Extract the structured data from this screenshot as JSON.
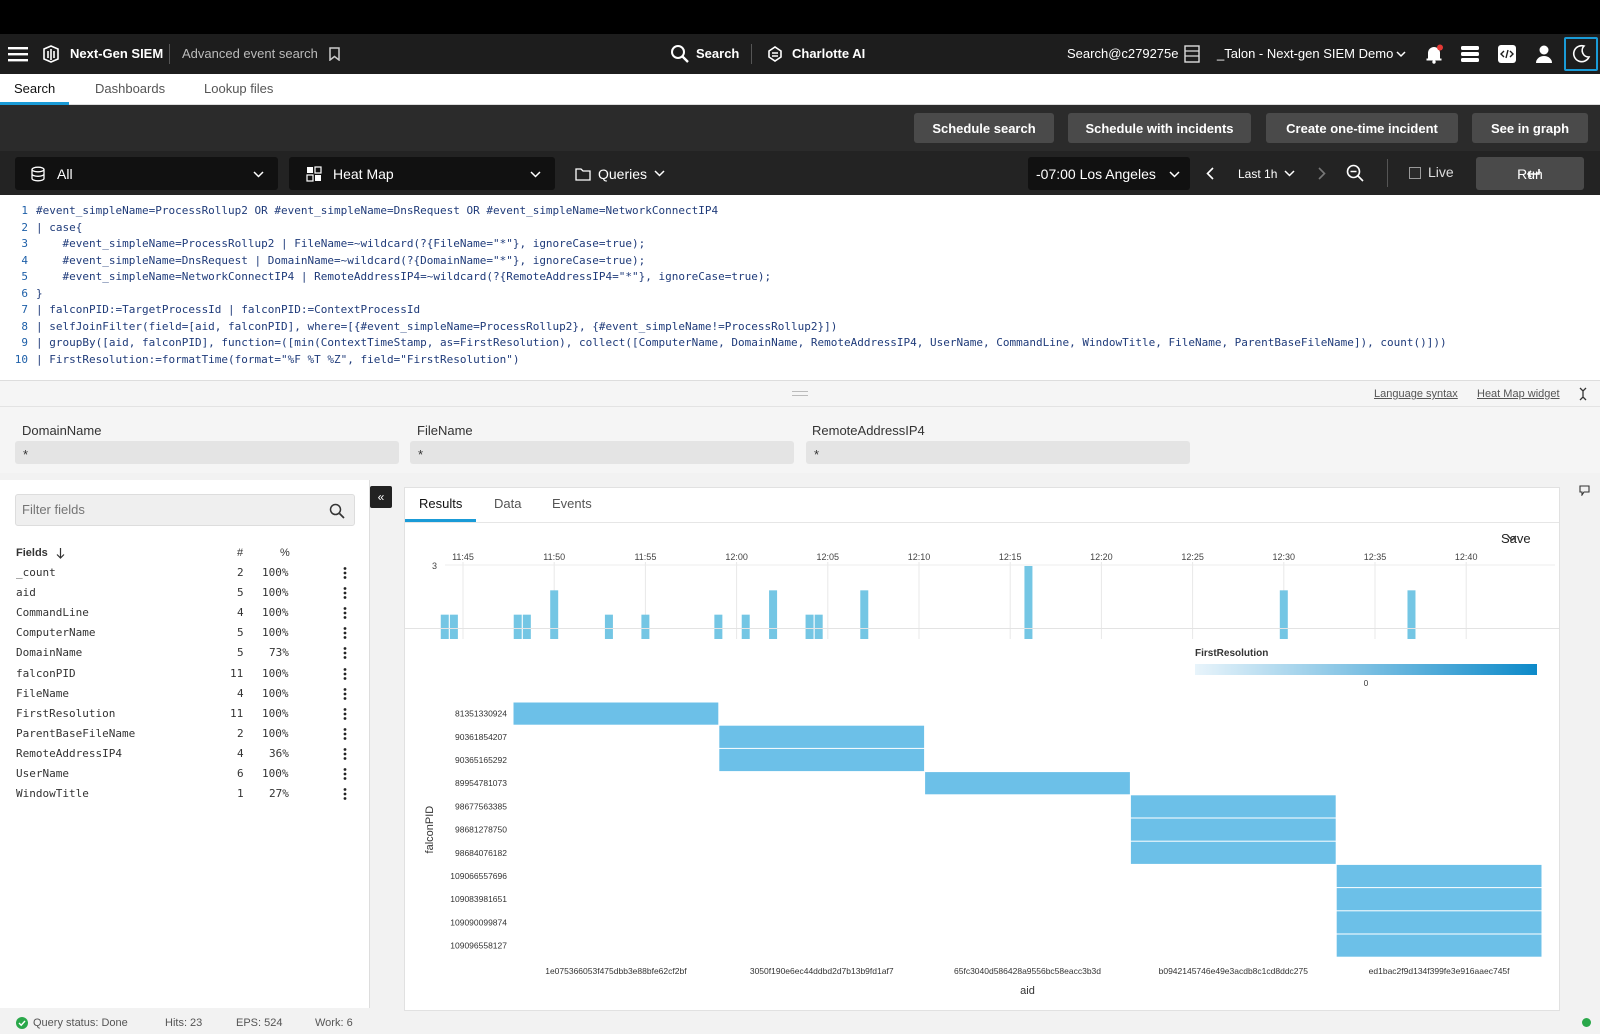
{
  "navbar": {
    "app_name": "Next-Gen SIEM",
    "page_title": "Advanced event search",
    "search_label": "Search",
    "charlotte_label": "Charlotte AI",
    "repo": "Search@c279275e",
    "tenant": "_Talon - Next-gen SIEM Demo"
  },
  "subtabs": [
    "Search",
    "Dashboards",
    "Lookup files"
  ],
  "actions": {
    "schedule_search": "Schedule search",
    "schedule_incidents": "Schedule with incidents",
    "create_incident": "Create one-time incident",
    "see_graph": "See in graph"
  },
  "querybar": {
    "repo_filter": "All",
    "widget": "Heat Map",
    "queries": "Queries",
    "timezone": "-07:00 Los Angeles",
    "timerange": "Last 1h",
    "live": "Live",
    "run": "Run"
  },
  "editor": {
    "lines": [
      {
        "n": "1",
        "code": "#event_simpleName=ProcessRollup2 OR #event_simpleName=DnsRequest OR #event_simpleName=NetworkConnectIP4"
      },
      {
        "n": "2",
        "code": "| case{"
      },
      {
        "n": "3",
        "code": "    #event_simpleName=ProcessRollup2 | FileName=~wildcard(?{FileName=\"*\"}, ignoreCase=true);"
      },
      {
        "n": "4",
        "code": "    #event_simpleName=DnsRequest | DomainName=~wildcard(?{DomainName=\"*\"}, ignoreCase=true);"
      },
      {
        "n": "5",
        "code": "    #event_simpleName=NetworkConnectIP4 | RemoteAddressIP4=~wildcard(?{RemoteAddressIP4=\"*\"}, ignoreCase=true);"
      },
      {
        "n": "6",
        "code": "}"
      },
      {
        "n": "7",
        "code": "| falconPID:=TargetProcessId | falconPID:=ContextProcessId"
      },
      {
        "n": "8",
        "code": "| selfJoinFilter(field=[aid, falconPID], where=[{#event_simpleName=ProcessRollup2}, {#event_simpleName!=ProcessRollup2}])"
      },
      {
        "n": "9",
        "code": "| groupBy([aid, falconPID], function=([min(ContextTimeStamp, as=FirstResolution), collect([ComputerName, DomainName, RemoteAddressIP4, UserName, CommandLine, WindowTitle, FileName, ParentBaseFileName]), count()]))"
      },
      {
        "n": "10",
        "code": "| FirstResolution:=formatTime(format=\"%F %T %Z\", field=\"FirstResolution\")"
      }
    ],
    "language_syntax": "Language syntax",
    "widget_link": "Heat Map widget"
  },
  "params": [
    {
      "label": "DomainName",
      "value": "*"
    },
    {
      "label": "FileName",
      "value": "*"
    },
    {
      "label": "RemoteAddressIP4",
      "value": "*"
    }
  ],
  "fields": {
    "filter_placeholder": "Filter fields",
    "header": {
      "name": "Fields",
      "count": "#",
      "pct": "%"
    },
    "rows": [
      {
        "name": "_count",
        "count": "2",
        "pct": "100%"
      },
      {
        "name": "aid",
        "count": "5",
        "pct": "100%"
      },
      {
        "name": "CommandLine",
        "count": "4",
        "pct": "100%"
      },
      {
        "name": "ComputerName",
        "count": "5",
        "pct": "100%"
      },
      {
        "name": "DomainName",
        "count": "5",
        "pct": "73%"
      },
      {
        "name": "falconPID",
        "count": "11",
        "pct": "100%"
      },
      {
        "name": "FileName",
        "count": "4",
        "pct": "100%"
      },
      {
        "name": "FirstResolution",
        "count": "11",
        "pct": "100%"
      },
      {
        "name": "ParentBaseFileName",
        "count": "2",
        "pct": "100%"
      },
      {
        "name": "RemoteAddressIP4",
        "count": "4",
        "pct": "36%"
      },
      {
        "name": "UserName",
        "count": "6",
        "pct": "100%"
      },
      {
        "name": "WindowTitle",
        "count": "1",
        "pct": "27%"
      }
    ]
  },
  "results": {
    "tabs": [
      "Results",
      "Data",
      "Events"
    ],
    "save": "Save"
  },
  "status": {
    "query_status": "Query status: Done",
    "hits": "Hits: 23",
    "eps": "EPS: 524",
    "work": "Work: 6"
  },
  "colors": {
    "accent": "#1a9bd7",
    "cell": "#6cc0e8",
    "hist_bar": "#74c6e4"
  },
  "chart_data": [
    {
      "type": "bar",
      "title": "",
      "x_ticks": [
        "11:45",
        "11:50",
        "11:55",
        "12:00",
        "12:05",
        "12:10",
        "12:15",
        "12:20",
        "12:25",
        "12:30",
        "12:35",
        "12:40"
      ],
      "ymax_label": "3",
      "ylim": [
        0,
        3
      ],
      "bars": [
        {
          "t": "11:44",
          "v": 1
        },
        {
          "t": "11:44.5",
          "v": 1
        },
        {
          "t": "11:48",
          "v": 1
        },
        {
          "t": "11:48.5",
          "v": 1
        },
        {
          "t": "11:50",
          "v": 2
        },
        {
          "t": "11:53",
          "v": 1
        },
        {
          "t": "11:55",
          "v": 1
        },
        {
          "t": "11:59",
          "v": 1
        },
        {
          "t": "12:00.5",
          "v": 1
        },
        {
          "t": "12:02",
          "v": 2
        },
        {
          "t": "12:04",
          "v": 1
        },
        {
          "t": "12:04.5",
          "v": 1
        },
        {
          "t": "12:07",
          "v": 2
        },
        {
          "t": "12:16",
          "v": 3
        },
        {
          "t": "12:30",
          "v": 2
        },
        {
          "t": "12:37",
          "v": 2
        }
      ]
    },
    {
      "type": "heatmap",
      "xlabel": "aid",
      "ylabel": "falconPID",
      "legend_title": "FirstResolution",
      "legend_tick": "0",
      "x": [
        "1e075366053f475dbb3e88bfe62cf2bf",
        "3050f190e6ec44ddbd2d7b13b9fd1af7",
        "65fc3040d586428a9556bc58eacc3b3d",
        "b0942145746e49e3acdb8c1cd8ddc275",
        "ed1bac2f9d134f399fe3e916aaec745f"
      ],
      "y": [
        "81351330924",
        "90361854207",
        "90365165292",
        "89954781073",
        "98677563385",
        "98681278750",
        "98684076182",
        "109066557696",
        "109083981651",
        "109090099874",
        "109096558127"
      ],
      "cells": [
        [
          0,
          0
        ],
        [
          1,
          1
        ],
        [
          1,
          2
        ],
        [
          2,
          3
        ],
        [
          3,
          4
        ],
        [
          3,
          5
        ],
        [
          3,
          6
        ],
        [
          4,
          7
        ],
        [
          4,
          8
        ],
        [
          4,
          9
        ],
        [
          4,
          10
        ]
      ]
    }
  ]
}
